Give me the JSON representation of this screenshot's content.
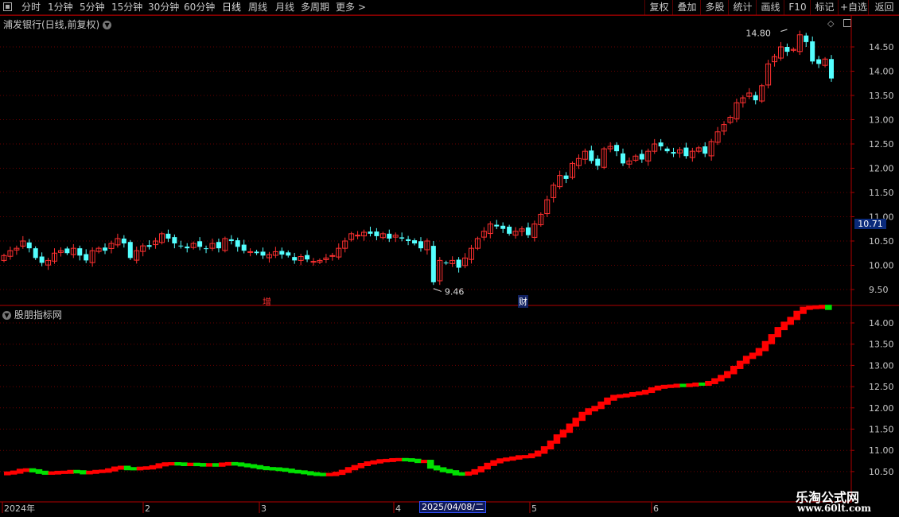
{
  "toolbar": {
    "left_items": [
      {
        "label": "分时",
        "x": 27
      },
      {
        "label": "1分钟",
        "x": 60
      },
      {
        "label": "5分钟",
        "x": 100
      },
      {
        "label": "15分钟",
        "x": 140
      },
      {
        "label": "30分钟",
        "x": 186
      },
      {
        "label": "60分钟",
        "x": 231
      },
      {
        "label": "日线",
        "x": 279
      },
      {
        "label": "周线",
        "x": 312
      },
      {
        "label": "月线",
        "x": 346
      },
      {
        "label": "多周期",
        "x": 378
      },
      {
        "label": "更多 >",
        "x": 422
      }
    ],
    "right_items": [
      {
        "label": "复权",
        "x": 810,
        "w": 35
      },
      {
        "label": "叠加",
        "x": 845,
        "w": 35
      },
      {
        "label": "多股",
        "x": 880,
        "w": 35
      },
      {
        "label": "统计",
        "x": 915,
        "w": 35
      },
      {
        "label": "画线",
        "x": 950,
        "w": 35
      },
      {
        "label": "F10",
        "x": 985,
        "w": 33
      },
      {
        "label": "标记",
        "x": 1018,
        "w": 35
      },
      {
        "label": "+自选",
        "x": 1053,
        "w": 38
      },
      {
        "label": "返回",
        "x": 1091,
        "w": 39
      }
    ],
    "active": "日线"
  },
  "chart_title": "浦发银行(日线,前复权)",
  "indicator_title": "股朋指标网",
  "price_tag": "10.71",
  "high_label": "14.80",
  "low_label": "9.46",
  "markers": {
    "zeng": "增",
    "cai": "财"
  },
  "selected_date": "2025/04/08/二",
  "watermark": {
    "line1": "乐淘公式网",
    "line2": "www.60lt.com"
  },
  "colors": {
    "up": "#ff3030",
    "down": "#54ffff",
    "grid": "#6a0000",
    "axis": "#b00000",
    "ind_up": "#ff0000",
    "ind_down": "#00e000"
  },
  "chart_data": [
    {
      "type": "candlestick",
      "name": "main",
      "y_ticks": [
        "14.50",
        "14.00",
        "13.50",
        "13.00",
        "12.50",
        "12.00",
        "11.50",
        "11.00",
        "10.50",
        "10.00",
        "9.50"
      ],
      "ylim": [
        9.3,
        14.9
      ],
      "x_labels": [
        "2024年",
        "2",
        "3",
        "4",
        "5",
        "6"
      ],
      "closes": [
        10.2,
        10.3,
        10.35,
        10.5,
        10.35,
        10.15,
        10.05,
        10.1,
        10.25,
        10.3,
        10.25,
        10.35,
        10.2,
        10.1,
        10.3,
        10.35,
        10.3,
        10.45,
        10.55,
        10.45,
        10.15,
        10.3,
        10.4,
        10.38,
        10.5,
        10.65,
        10.55,
        10.45,
        10.4,
        10.35,
        10.45,
        10.38,
        10.35,
        10.45,
        10.35,
        10.55,
        10.5,
        10.38,
        10.3,
        10.28,
        10.25,
        10.2,
        10.22,
        10.28,
        10.22,
        10.2,
        10.1,
        10.18,
        10.12,
        10.08,
        10.1,
        10.15,
        10.2,
        10.35,
        10.5,
        10.65,
        10.62,
        10.68,
        10.65,
        10.6,
        10.65,
        10.55,
        10.62,
        10.55,
        10.5,
        10.45,
        10.35,
        10.5,
        9.65,
        10.1,
        10.05,
        10.1,
        9.95,
        10.15,
        10.35,
        10.55,
        10.7,
        10.85,
        10.8,
        10.75,
        10.65,
        10.7,
        10.75,
        10.62,
        10.85,
        11.05,
        11.35,
        11.65,
        11.85,
        11.78,
        12.1,
        12.2,
        12.35,
        12.15,
        12.05,
        12.4,
        12.45,
        12.35,
        12.1,
        12.15,
        12.25,
        12.18,
        12.35,
        12.5,
        12.45,
        12.35,
        12.3,
        12.38,
        12.25,
        12.35,
        12.42,
        12.3,
        12.55,
        12.75,
        12.9,
        13.05,
        13.35,
        13.45,
        13.55,
        13.4,
        13.7,
        14.15,
        14.3,
        14.5,
        14.4,
        14.45,
        14.75,
        14.6,
        14.2,
        14.15,
        14.25,
        13.85
      ]
    },
    {
      "type": "line",
      "name": "indicator",
      "y_ticks": [
        "14.00",
        "13.50",
        "13.00",
        "12.50",
        "12.00",
        "11.50",
        "11.00",
        "10.50"
      ],
      "ylim": [
        9.8,
        14.1
      ],
      "values_by_index": "derived by smoothing main series"
    }
  ]
}
